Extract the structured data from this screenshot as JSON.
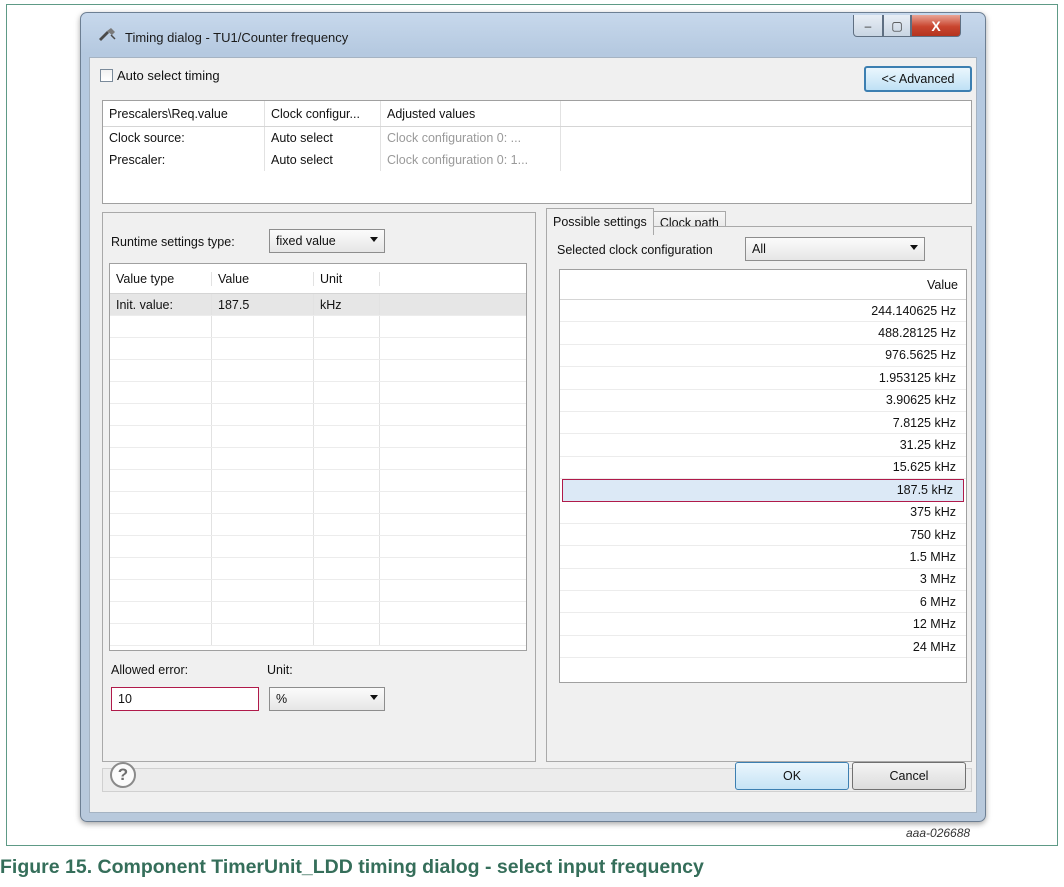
{
  "window": {
    "title": "Timing dialog - TU1/Counter frequency",
    "minimize": "–",
    "maximize": "▢",
    "close": "X"
  },
  "auto_select": {
    "label": "Auto select timing",
    "checked": false
  },
  "advanced_button": "<< Advanced",
  "top_table": {
    "headers": [
      "Prescalers\\Req.value",
      "Clock configur...",
      "Adjusted values"
    ],
    "rows": [
      [
        "Clock source:",
        "Auto select",
        "Clock configuration 0: ..."
      ],
      [
        "Prescaler:",
        "Auto select",
        "Clock configuration 0: 1..."
      ]
    ]
  },
  "runtime": {
    "label": "Runtime settings type:",
    "selected": "fixed value"
  },
  "value_table": {
    "headers": [
      "Value type",
      "Value",
      "Unit"
    ],
    "rows": [
      [
        "Init. value:",
        "187.5",
        "kHz"
      ]
    ]
  },
  "allowed_error": {
    "label": "Allowed error:",
    "value": "10"
  },
  "unit": {
    "label": "Unit:",
    "selected": "%"
  },
  "tabs": [
    "Possible settings",
    "Clock path"
  ],
  "selected_clock": {
    "label": "Selected clock configuration",
    "selected": "All"
  },
  "possible_values": {
    "header": "Value",
    "selected_value": "187.5 kHz",
    "items": [
      "244.140625 Hz",
      "488.28125 Hz",
      "976.5625 Hz",
      "1.953125 kHz",
      "3.90625 kHz",
      "7.8125 kHz",
      "31.25 kHz",
      "15.625 kHz",
      "187.5 kHz",
      "375 kHz",
      "750 kHz",
      "1.5 MHz",
      "3 MHz",
      "6 MHz",
      "12 MHz",
      "24 MHz"
    ]
  },
  "buttons": {
    "help": "?",
    "ok": "OK",
    "cancel": "Cancel"
  },
  "figure_id": "aaa-026688",
  "caption": "Figure 15. Component TimerUnit_LDD timing dialog - select input frequency"
}
